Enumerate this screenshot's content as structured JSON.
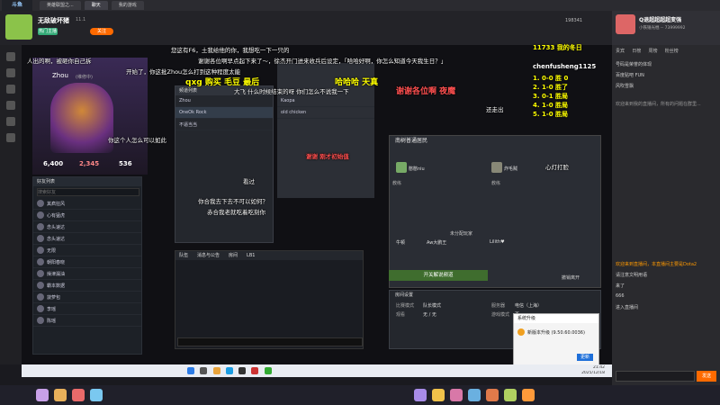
{
  "browser": {
    "tabs": [
      "英雄联盟之...",
      "聊天",
      "我的游戏"
    ],
    "logo": "斗鱼"
  },
  "header": {
    "streamer_name": "无敌破坏猪",
    "level": "11.1",
    "follow_label": "关注",
    "follow_count": "198341",
    "badge": "热门主播"
  },
  "game": {
    "hero_player": "Zhou",
    "hero_tag": "(维修中)",
    "stats": [
      {
        "label": "6,400"
      },
      {
        "label": "2,345"
      },
      {
        "label": "536"
      }
    ],
    "friend_search_placeholder": "搜索好友",
    "friend_header": "好友列表",
    "friends": [
      {
        "name": "其疯狂风",
        "status": "在线"
      },
      {
        "name": "心有猛虎",
        "status": "在线"
      },
      {
        "name": "念头速达",
        "status": "在线"
      },
      {
        "name": "念头速达",
        "status": "在线"
      },
      {
        "name": "无限",
        "status": "在线"
      },
      {
        "name": "朝阳春晓",
        "status": "在线"
      },
      {
        "name": "燥津漏油",
        "status": "离线"
      },
      {
        "name": "霸本数据",
        "status": "离线"
      },
      {
        "name": "菠萝包",
        "status": "离线"
      },
      {
        "name": "李瑶",
        "status": "离线"
      },
      {
        "name": "陈瑶",
        "status": "离线"
      }
    ],
    "lobby_mid_title": "频道列表",
    "lobby_mid_items": [
      "Zhou",
      "OneOk Rock",
      "不逼当当"
    ],
    "center_items": [
      "Kaopa",
      "old chicken"
    ],
    "right_lobby_title": "南树普通居民",
    "teams": [
      {
        "name": "憨憨niu",
        "role": "教练"
      },
      {
        "name": "炸毛贼",
        "role": "教练"
      }
    ],
    "unassigned_label": "未分配玩家",
    "unassigned": [
      "牛顿",
      "Aw大鹏王",
      "Lilith♥"
    ],
    "start_button": "开关解说频道",
    "leave_button": "撤销离开",
    "settings_title": "房间设置",
    "settings_rows": [
      {
        "k": "比赛模式",
        "v": "队长模式"
      },
      {
        "k": "服务器",
        "v": "电信（上海）"
      },
      {
        "k": "观看",
        "v": "无 / 无"
      },
      {
        "k": "游戏模式",
        "v": "否"
      }
    ],
    "chat_tabs": [
      "队伍",
      "消息与公告",
      "房间",
      "LB1"
    ],
    "chat_send": "频道"
  },
  "dialog": {
    "title": "系统升级",
    "body": "新版本升级 (9.50.60.0036)",
    "ok": "更新"
  },
  "danmaku": [
    {
      "text": "您这有F6，土我给他的你，我想吃一下一只的",
      "cls": "dm"
    },
    {
      "text": "谢谢各位啊早点起下来了～，徐杰开门进来收兵后设定，「哈哈好啊，你怎么知道今天我生日？」",
      "cls": "dm"
    },
    {
      "text": "人出的啊，被砸你自己拆",
      "cls": "dm"
    },
    {
      "text": "开始了，你这批Zhou怎么打到这种程度太能",
      "cls": "dm"
    },
    {
      "text": "qxg 购买 毛豆 最后",
      "cls": "dm y big"
    },
    {
      "text": "哈哈哈 天真",
      "cls": "dm y big"
    },
    {
      "text": "谢谢各位啊 夜魔",
      "cls": "dm r big"
    },
    {
      "text": "大飞 什么时候结束的呀 你们怎么不说我一下",
      "cls": "dm"
    },
    {
      "text": "你这个人怎么可以如此",
      "cls": "dm"
    },
    {
      "text": "看过",
      "cls": "dm"
    },
    {
      "text": "谢谢 刚才初始值",
      "cls": "dm r"
    },
    {
      "text": "赤合我老就吃着吃刻你",
      "cls": "dm"
    },
    {
      "text": "你合我去下去不可以如何？",
      "cls": "dm"
    },
    {
      "text": "还走出",
      "cls": "dm"
    },
    {
      "text": "心灯打脸",
      "cls": "dm"
    }
  ],
  "rank_board": {
    "top": "11733 我的冬日",
    "second": "chenfusheng1125",
    "rows": [
      "1. 0-0 胜 0",
      "2. 1-0 胜了",
      "3. 0-1 胜局",
      "4. 1-0 胜局",
      "5. 1-0 胜局"
    ]
  },
  "sidebar": {
    "title": "Q退超超超超变强",
    "subtitle": "小铁锤光棍 -- 73999992",
    "tabs": [
      "贵宾",
      "日榜",
      "周榜",
      "粉丝榜"
    ],
    "ranks": [
      {
        "name": "号码是荣誉的体现",
        "score": ""
      },
      {
        "name": "百度贴吧 FUN",
        "score": ""
      },
      {
        "name": "风吹雪飘",
        "score": ""
      }
    ],
    "notice": "欢迎来到我的直播间，所有的问题在群里...",
    "chat": [
      {
        "user": "超粉",
        "text": "欢迎来到直播间，本直播间主要是Dota2"
      },
      {
        "user": "系统公告",
        "text": "请注意文明用语"
      },
      {
        "user": "小鱼",
        "text": "来了"
      },
      {
        "user": "路人",
        "text": "666"
      },
      {
        "user": "超粉",
        "text": "进入直播间"
      }
    ],
    "send_label": "发送"
  },
  "taskbar": {
    "time": "21:42",
    "date": "2025/12/18"
  },
  "colors": {
    "accent": "#ff6a00",
    "danmaku_yellow": "#ffff00",
    "danmaku_red": "#ff5050",
    "taskbar": "#e9ecf2"
  }
}
